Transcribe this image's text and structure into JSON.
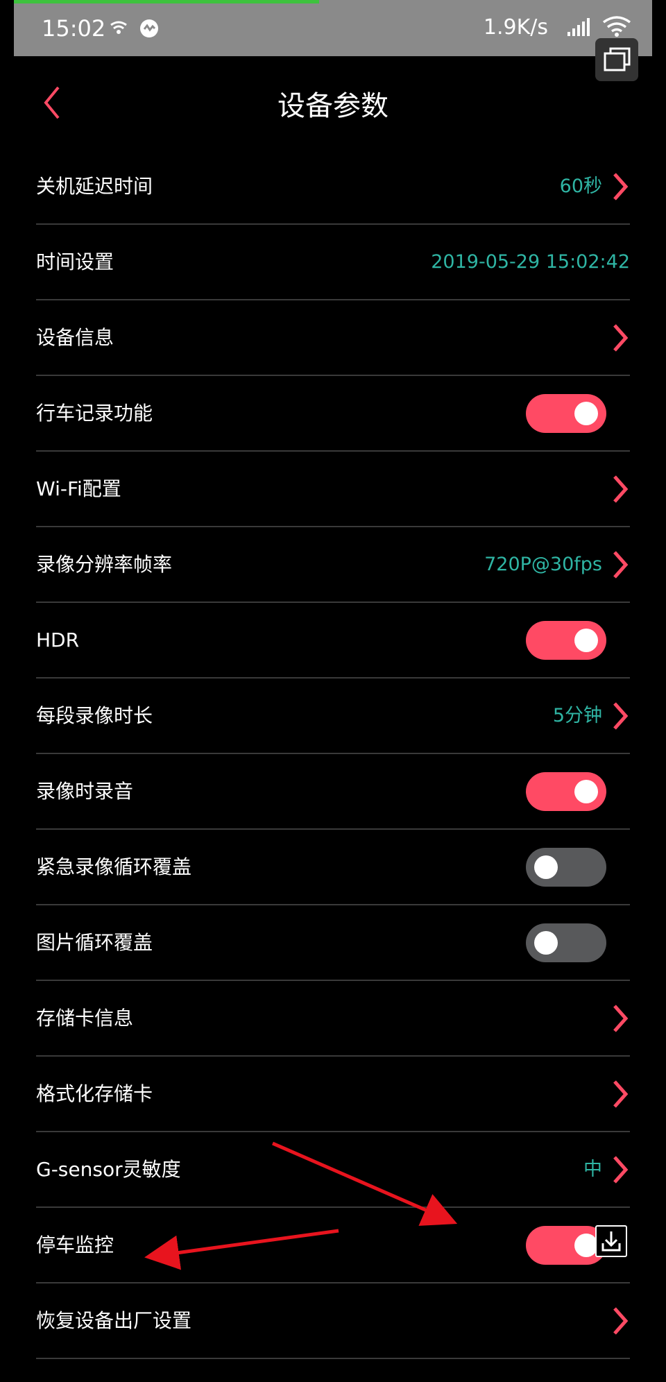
{
  "status_bar": {
    "time": "15:02",
    "speed": "1.9K/s"
  },
  "header": {
    "title": "设备参数"
  },
  "colors": {
    "accent": "#ff4a64",
    "value": "#2fb5a4",
    "toggle_off": "#58595b"
  },
  "rows": [
    {
      "label": "关机延迟时间",
      "value": "60秒",
      "control": "arrow"
    },
    {
      "label": "时间设置",
      "value": "2019-05-29 15:02:42",
      "control": "none"
    },
    {
      "label": "设备信息",
      "value": "",
      "control": "arrow"
    },
    {
      "label": "行车记录功能",
      "value": "",
      "control": "toggle",
      "on": true
    },
    {
      "label": "Wi-Fi配置",
      "value": "",
      "control": "arrow"
    },
    {
      "label": "录像分辨率帧率",
      "value": "720P@30fps",
      "control": "arrow"
    },
    {
      "label": "HDR",
      "value": "",
      "control": "toggle",
      "on": true
    },
    {
      "label": "每段录像时长",
      "value": "5分钟",
      "control": "arrow"
    },
    {
      "label": "录像时录音",
      "value": "",
      "control": "toggle",
      "on": true
    },
    {
      "label": "紧急录像循环覆盖",
      "value": "",
      "control": "toggle",
      "on": false
    },
    {
      "label": "图片循环覆盖",
      "value": "",
      "control": "toggle",
      "on": false
    },
    {
      "label": "存储卡信息",
      "value": "",
      "control": "arrow"
    },
    {
      "label": "格式化存储卡",
      "value": "",
      "control": "arrow"
    },
    {
      "label": "G-sensor灵敏度",
      "value": "中",
      "control": "arrow"
    },
    {
      "label": "停车监控",
      "value": "",
      "control": "toggle",
      "on": true
    },
    {
      "label": "恢复设备出厂设置",
      "value": "",
      "control": "arrow"
    }
  ]
}
